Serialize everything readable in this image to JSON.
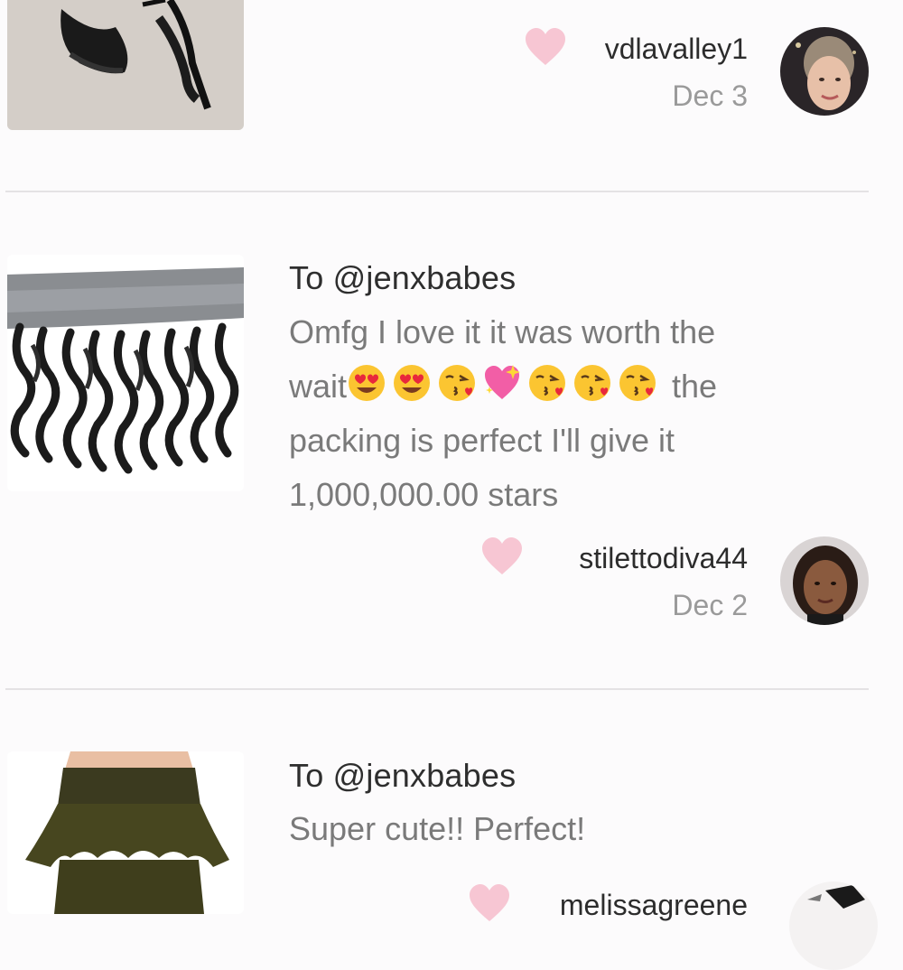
{
  "reviews": [
    {
      "username": "vdlavalley1",
      "date": "Dec 3",
      "thumb_icon": "black-strappy-heels-photo",
      "avatar_icon": "user-avatar-blonde-woman"
    },
    {
      "to": "To @jenxbabes",
      "text_line1": "Omfg I love it it was worth the",
      "text_wait": "wait",
      "text_the": " the",
      "text_line3": "packing is perfect I'll give it",
      "text_line4": "1,000,000.00 stars",
      "emojis": [
        "heart-eyes-emoji",
        "heart-eyes-emoji",
        "kiss-emoji",
        "sparkling-heart-emoji",
        "kiss-emoji",
        "kiss-emoji",
        "kiss-emoji"
      ],
      "username": "stilettodiva44",
      "date": "Dec 2",
      "thumb_icon": "curly-hair-lace-frontal-photo",
      "avatar_icon": "user-avatar-woman"
    },
    {
      "to": "To @jenxbabes",
      "text": "Super cute!! Perfect!",
      "username": "melissagreene",
      "thumb_icon": "olive-peplum-skirt-photo",
      "avatar_icon": "user-avatar-partial"
    }
  ],
  "colors": {
    "heart": "#f7c6d3",
    "divider": "#e4e2e4",
    "text_dark": "#2e2e2e",
    "text_muted": "#7a7a7a"
  }
}
